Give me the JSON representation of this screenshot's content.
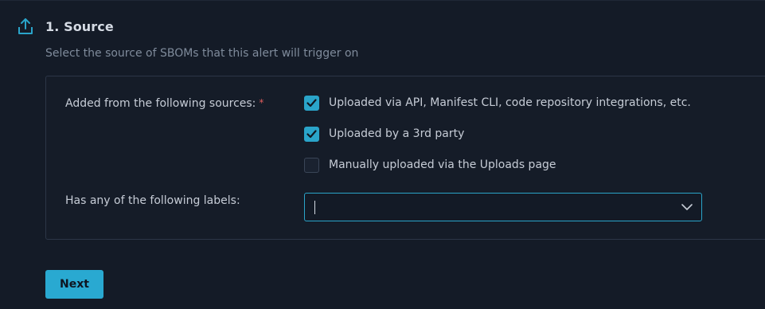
{
  "section": {
    "title": "1. Source",
    "subtitle": "Select the source of SBOMs that this alert will trigger on",
    "icon": "upload-icon"
  },
  "sources_field": {
    "label": "Added from the following sources:",
    "required_marker": "*",
    "options": [
      {
        "label": "Uploaded via API, Manifest CLI, code repository integrations, etc.",
        "checked": true
      },
      {
        "label": "Uploaded by a 3rd party",
        "checked": true
      },
      {
        "label": "Manually uploaded via the Uploads page",
        "checked": false
      }
    ]
  },
  "labels_field": {
    "label": "Has any of the following labels:",
    "value": "",
    "icon": "chevron-down-icon"
  },
  "actions": {
    "next_label": "Next"
  },
  "colors": {
    "accent": "#29a9d1",
    "background": "#141b27",
    "required": "#e05d5d"
  }
}
